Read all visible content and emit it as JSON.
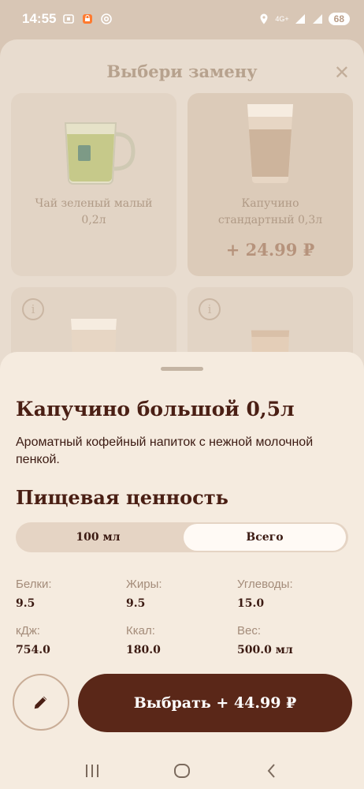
{
  "status_bar": {
    "time": "14:55",
    "network": "4G+",
    "battery": "68"
  },
  "background_modal": {
    "title": "Выбери замену",
    "cards": [
      {
        "name": "Чай зеленый малый\n0,2л",
        "price": ""
      },
      {
        "name": "Капучино\nстандартный 0,3л",
        "price": "+ 24.99 ₽"
      }
    ]
  },
  "sheet": {
    "product_title": "Капучино большой 0,5л",
    "description": "Ароматный кофейный напиток  с  нежной молочной пенкой.",
    "nutrition_title": "Пищевая ценность",
    "tabs": [
      {
        "label": "100 мл",
        "active": false
      },
      {
        "label": "Всего",
        "active": true
      }
    ],
    "nutrition": {
      "protein": {
        "label": "Белки:",
        "value": "9.5"
      },
      "fat": {
        "label": "Жиры:",
        "value": "9.5"
      },
      "carbs": {
        "label": "Углеводы:",
        "value": "15.0"
      },
      "kj": {
        "label": "кДж:",
        "value": "754.0"
      },
      "kcal": {
        "label": "Ккал:",
        "value": "180.0"
      },
      "weight": {
        "label": "Вес:",
        "value": "500.0 мл"
      }
    },
    "select_button": "Выбрать + 44.99 ₽"
  },
  "info_glyph": "i",
  "colors": {
    "accent": "#5a2718",
    "sheet_bg": "#f5ebdf",
    "overlay_bg": "#e8dccf"
  }
}
